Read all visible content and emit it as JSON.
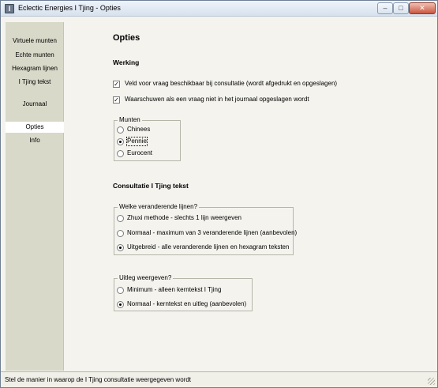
{
  "window": {
    "app_icon": "I",
    "title": "Eclectic Energies I Tjing - Opties",
    "buttons": {
      "minimize": "–",
      "maximize": "□",
      "close": "✕"
    }
  },
  "sidebar": {
    "items": [
      {
        "label": "Virtuele munten",
        "active": false
      },
      {
        "label": "Echte munten",
        "active": false
      },
      {
        "label": "Hexagram lijnen",
        "active": false
      },
      {
        "label": "I Tjing tekst",
        "active": false
      },
      {
        "label": "Journaal",
        "active": false
      },
      {
        "label": "Opties",
        "active": true
      },
      {
        "label": "Info",
        "active": false
      }
    ]
  },
  "main": {
    "title": "Opties",
    "werking": {
      "heading": "Werking",
      "checkboxes": [
        {
          "label": "Veld voor vraag beschikbaar bij consultatie (wordt afgedrukt en opgeslagen)",
          "checked": true,
          "mark": "✓"
        },
        {
          "label": "Waarschuwen als een vraag niet in het journaal opgeslagen wordt",
          "checked": true,
          "mark": "✓"
        }
      ],
      "munten": {
        "legend": "Munten",
        "options": [
          {
            "label": "Chinees",
            "selected": false
          },
          {
            "label": "Pennie",
            "selected": true
          },
          {
            "label": "Eurocent",
            "selected": false
          }
        ]
      }
    },
    "consultatie": {
      "heading": "Consultatie I Tjing tekst",
      "lijnen": {
        "legend": "Welke veranderende lijnen?",
        "options": [
          {
            "label": "Zhuxi methode - slechts 1 lijn weergeven",
            "selected": false
          },
          {
            "label": "Normaal - maximum van 3 veranderende lijnen (aanbevolen)",
            "selected": false
          },
          {
            "label": "Uitgebreid - alle veranderende lijnen en hexagram teksten",
            "selected": true
          }
        ]
      },
      "uitleg": {
        "legend": "Uitleg weergeven?",
        "options": [
          {
            "label": "Minimum - alleen kerntekst I Tjing",
            "selected": false
          },
          {
            "label": "Normaal - kerntekst en uitleg (aanbevolen)",
            "selected": true
          }
        ]
      }
    }
  },
  "statusbar": {
    "text": "Stel de manier in waarop de I Tjing consultatie weergegeven wordt"
  }
}
